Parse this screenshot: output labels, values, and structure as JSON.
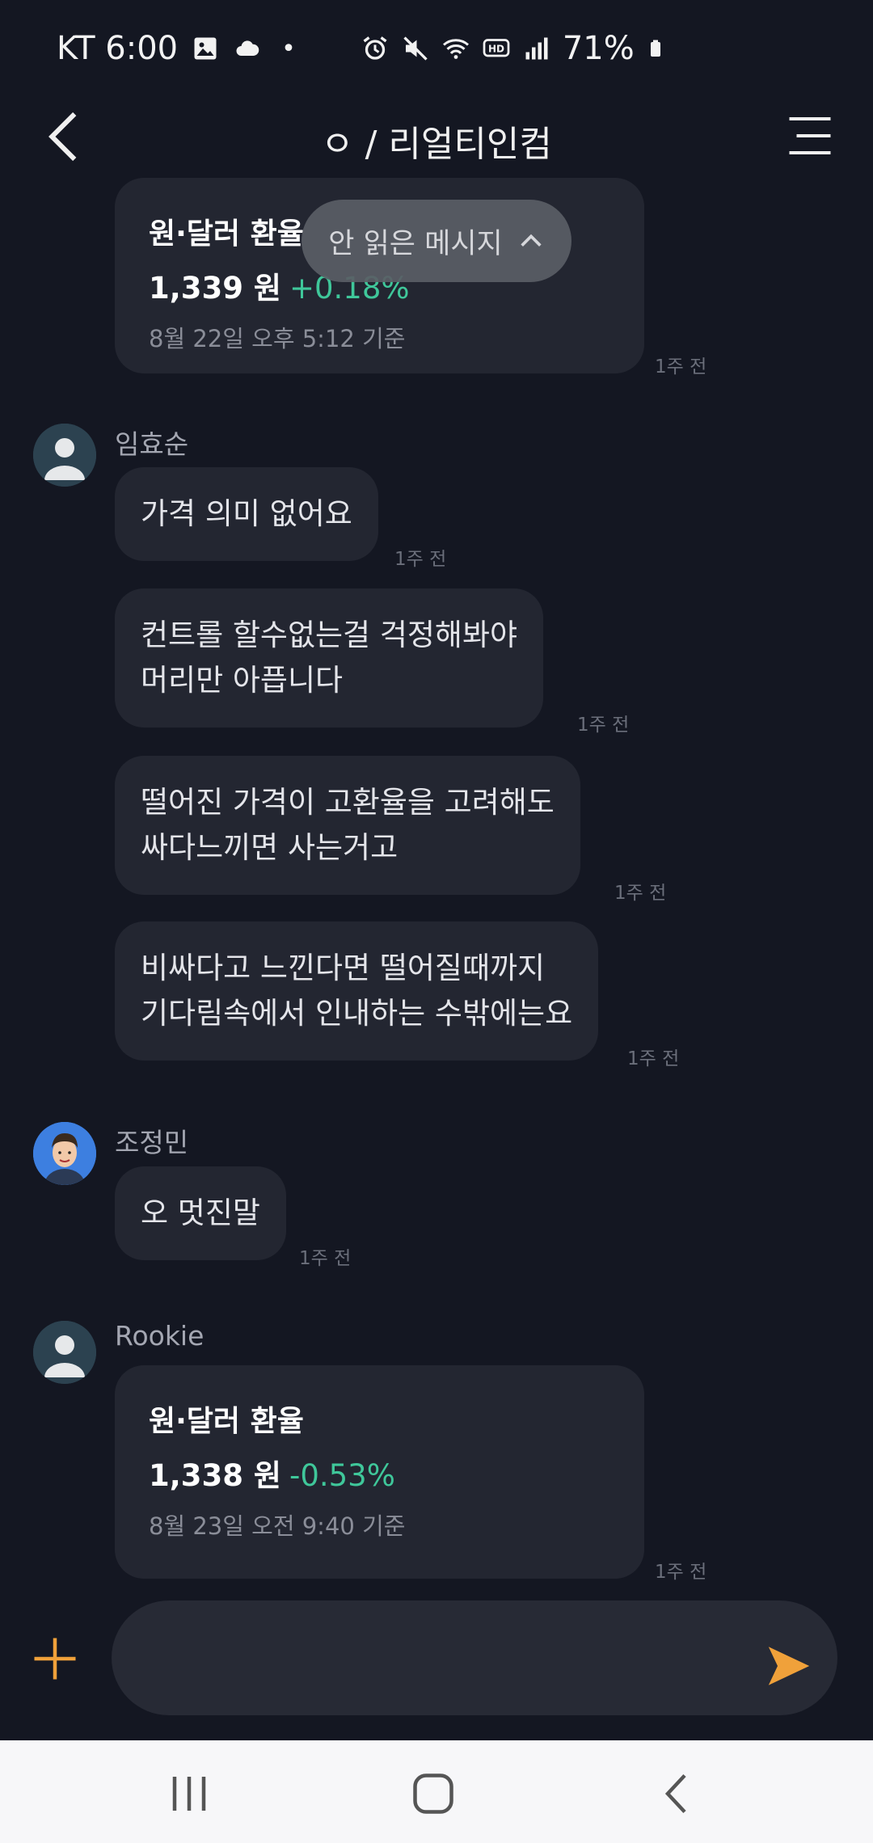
{
  "status": {
    "carrier_time": "KT 6:00",
    "dot": "•",
    "battery_pct": "71%"
  },
  "header": {
    "title": "ㅇ / 리얼티인컴"
  },
  "unread_button": {
    "label": "안 읽은 메시지"
  },
  "messages": {
    "card1": {
      "title": "원·달러 환율",
      "value": "1,339 원",
      "change": "+0.18%",
      "subtitle": "8월 22일 오후 5:12 기준",
      "time": "1주 전"
    },
    "sender1": "임효순",
    "m1": {
      "text": "가격 의미 없어요",
      "time": "1주 전"
    },
    "m2": {
      "text": "컨트롤 할수없는걸 걱정해봐야\n머리만 아픕니다",
      "time": "1주 전"
    },
    "m3": {
      "text": "떨어진 가격이 고환율을 고려해도\n싸다느끼면 사는거고",
      "time": "1주 전"
    },
    "m4": {
      "text": "비싸다고 느낀다면 떨어질때까지\n기다림속에서 인내하는 수밖에는요",
      "time": "1주 전"
    },
    "sender2": "조정민",
    "m5": {
      "text": "오 멋진말",
      "time": "1주 전"
    },
    "sender3": "Rookie",
    "card2": {
      "title": "원·달러 환율",
      "value": "1,338 원",
      "change": "-0.53%",
      "subtitle": "8월 23일 오전 9:40 기준",
      "time": "1주 전"
    }
  },
  "input": {
    "placeholder": ""
  },
  "colors": {
    "background": "#141722",
    "bubble": "#232631",
    "accent": "#f0a13a",
    "change_green": "#3fc79a"
  },
  "icons": [
    "back-icon",
    "menu-icon",
    "plus-icon",
    "send-icon",
    "recent-apps-icon",
    "home-icon",
    "nav-back-icon"
  ]
}
